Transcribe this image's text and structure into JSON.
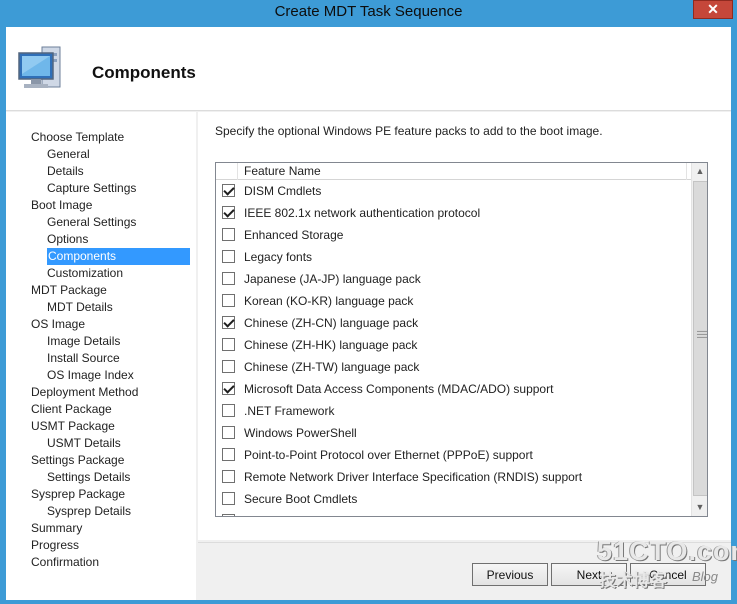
{
  "window": {
    "title": "Create MDT Task Sequence",
    "close_glyph": "✕"
  },
  "header": {
    "title": "Components",
    "icon": "computer-monitor-icon"
  },
  "nav": {
    "items": [
      {
        "label": "Choose Template",
        "level": 1
      },
      {
        "label": "General",
        "level": 2
      },
      {
        "label": "Details",
        "level": 2
      },
      {
        "label": "Capture Settings",
        "level": 2
      },
      {
        "label": "Boot Image",
        "level": 1
      },
      {
        "label": "General Settings",
        "level": 2
      },
      {
        "label": "Options",
        "level": 2
      },
      {
        "label": "Components",
        "level": 2,
        "selected": true
      },
      {
        "label": "Customization",
        "level": 2
      },
      {
        "label": "MDT Package",
        "level": 1
      },
      {
        "label": "MDT Details",
        "level": 2
      },
      {
        "label": "OS Image",
        "level": 1
      },
      {
        "label": "Image Details",
        "level": 2
      },
      {
        "label": "Install Source",
        "level": 2
      },
      {
        "label": "OS Image Index",
        "level": 2
      },
      {
        "label": "Deployment Method",
        "level": 1
      },
      {
        "label": "Client Package",
        "level": 1
      },
      {
        "label": "USMT Package",
        "level": 1
      },
      {
        "label": "USMT Details",
        "level": 2
      },
      {
        "label": "Settings Package",
        "level": 1
      },
      {
        "label": "Settings Details",
        "level": 2
      },
      {
        "label": "Sysprep Package",
        "level": 1
      },
      {
        "label": "Sysprep Details",
        "level": 2
      },
      {
        "label": "Summary",
        "level": 1
      },
      {
        "label": "Progress",
        "level": 1
      },
      {
        "label": "Confirmation",
        "level": 1
      }
    ]
  },
  "main": {
    "instruction": "Specify the optional Windows PE feature packs to add to the boot image.",
    "column_header": "Feature Name",
    "features": [
      {
        "label": "DISM Cmdlets",
        "checked": true
      },
      {
        "label": "IEEE 802.1x network authentication protocol",
        "checked": true
      },
      {
        "label": "Enhanced Storage",
        "checked": false
      },
      {
        "label": "Legacy fonts",
        "checked": false
      },
      {
        "label": "Japanese (JA-JP) language pack",
        "checked": false
      },
      {
        "label": "Korean (KO-KR) language pack",
        "checked": false
      },
      {
        "label": "Chinese (ZH-CN) language pack",
        "checked": true
      },
      {
        "label": "Chinese (ZH-HK) language pack",
        "checked": false
      },
      {
        "label": "Chinese (ZH-TW) language pack",
        "checked": false
      },
      {
        "label": "Microsoft Data Access Components (MDAC/ADO) support",
        "checked": true
      },
      {
        "label": ".NET Framework",
        "checked": false
      },
      {
        "label": "Windows PowerShell",
        "checked": false
      },
      {
        "label": "Point-to-Point Protocol over Ethernet (PPPoE) support",
        "checked": false
      },
      {
        "label": "Remote Network Driver Interface Specification (RNDIS) support",
        "checked": false
      },
      {
        "label": "Secure Boot Cmdlets",
        "checked": false
      },
      {
        "label": "",
        "checked": false
      }
    ]
  },
  "buttons": {
    "previous": "Previous",
    "next": "Next",
    "cancel": "Cancel"
  },
  "watermark": {
    "main": "51CTO.com",
    "sub": "技术博客",
    "blog": "Blog"
  }
}
